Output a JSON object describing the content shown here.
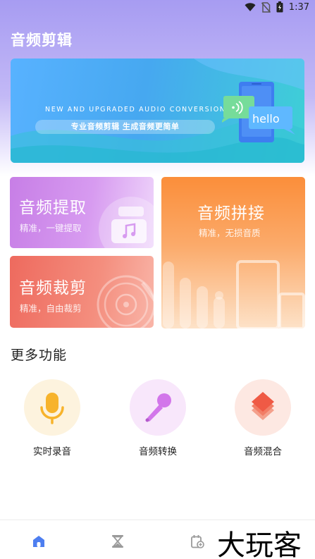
{
  "status_bar": {
    "time": "1:37"
  },
  "app": {
    "title": "音频剪辑"
  },
  "banner": {
    "headline_en": "NEW AND UPGRADED AUDIO CONVERSION",
    "tagline": "专业音频剪辑   生成音频更简单",
    "bubble_text": "hello"
  },
  "cards": {
    "extract": {
      "title": "音频提取",
      "subtitle": "精准，一键提取"
    },
    "cut": {
      "title": "音频裁剪",
      "subtitle": "精准，自由裁剪"
    },
    "join": {
      "title": "音频拼接",
      "subtitle": "精准，无损音质"
    }
  },
  "more_features": {
    "title": "更多功能",
    "items": [
      {
        "label": "实时录音",
        "icon": "microphone-icon",
        "bg": "#fdf3de"
      },
      {
        "label": "音频转换",
        "icon": "karaoke-mic-icon",
        "bg": "#f8e7fb"
      },
      {
        "label": "音频混合",
        "icon": "layers-icon",
        "bg": "#fde8e2"
      }
    ]
  },
  "tab_bar": {
    "tabs": [
      {
        "icon": "home-icon"
      },
      {
        "icon": "hourglass-icon"
      },
      {
        "icon": "calendar-add-icon"
      }
    ]
  },
  "watermark": {
    "text": "大玩客"
  },
  "colors": {
    "accent": "#a79cf2",
    "home_active": "#4d7ef0"
  }
}
